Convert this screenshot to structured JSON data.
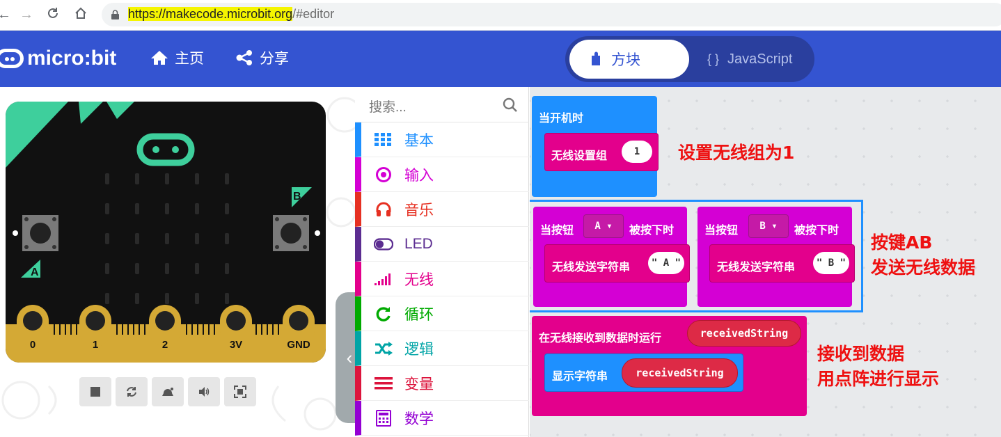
{
  "browser": {
    "url_highlight": "https://makecode.microbit.org",
    "url_rest": "/#editor"
  },
  "header": {
    "logo_text": "micro:bit",
    "home_label": "主页",
    "share_label": "分享",
    "blocks_tab": "方块",
    "js_tab": "JavaScript",
    "js_brace": "{ }"
  },
  "simulator": {
    "pins": [
      "0",
      "1",
      "2",
      "3V",
      "GND"
    ],
    "button_a": "A",
    "button_b": "B",
    "collapse_glyph": "‹"
  },
  "toolbox": {
    "search_placeholder": "搜索...",
    "categories": [
      {
        "label": "基本",
        "color": "#1e90ff",
        "icon": "grid-icon"
      },
      {
        "label": "输入",
        "color": "#d400d4",
        "icon": "target-icon"
      },
      {
        "label": "音乐",
        "color": "#e63022",
        "icon": "headphones-icon"
      },
      {
        "label": "LED",
        "color": "#5c2d91",
        "icon": "toggle-icon"
      },
      {
        "label": "无线",
        "color": "#e3008c",
        "icon": "signal-icon"
      },
      {
        "label": "循环",
        "color": "#00aa00",
        "icon": "loop-icon"
      },
      {
        "label": "逻辑",
        "color": "#00a4a6",
        "icon": "shuffle-icon"
      },
      {
        "label": "变量",
        "color": "#dc143c",
        "icon": "lines-icon"
      },
      {
        "label": "数学",
        "color": "#9400d3",
        "icon": "calculator-icon"
      }
    ]
  },
  "workspace": {
    "on_start": "当开机时",
    "set_group": "无线设置组",
    "group_value": "1",
    "btn_a_when": "当按钮",
    "btn_a_value": "A ▾",
    "btn_a_pressed": "被按下时",
    "send_a": "无线发送字符串",
    "send_a_value": "\" A \"",
    "btn_b_when": "当按钮",
    "btn_b_value": "B ▾",
    "btn_b_pressed": "被按下时",
    "send_b": "无线发送字符串",
    "send_b_value": "\" B \"",
    "on_receive": "在无线接收到数据时运行",
    "received_var": "receivedString",
    "show_string": "显示字符串",
    "show_var": "receivedString"
  },
  "annotations": {
    "note1": "设置无线组为1",
    "note2_line1": "按键AB",
    "note2_line2": "发送无线数据",
    "note3_line1": "接收到数据",
    "note3_line2": "用点阵进行显示"
  },
  "colors": {
    "header": "#3454d1",
    "basic_block": "#1e90ff",
    "radio_block": "#e3008c",
    "input_block": "#d400d4",
    "note_red": "#ee1111"
  }
}
